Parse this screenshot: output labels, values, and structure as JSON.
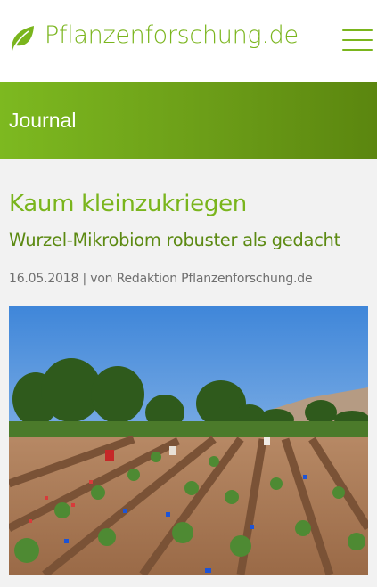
{
  "header": {
    "brand": "Pflanzenforschung.de",
    "logo_icon": "leaf-icon",
    "menu_icon": "hamburger-menu-icon",
    "brand_color": "#7ab51d"
  },
  "banner": {
    "title": "Journal",
    "color_start": "#7db920",
    "color_end": "#5b860f"
  },
  "article": {
    "headline": "Kaum kleinzukriegen",
    "subheadline": "Wurzel-Mikrobiom robuster als gedacht",
    "date": "16.05.2018",
    "separator": "|",
    "author": "von Redaktion Pflanzenforschung.de",
    "image_description_icon": "field-photo"
  }
}
